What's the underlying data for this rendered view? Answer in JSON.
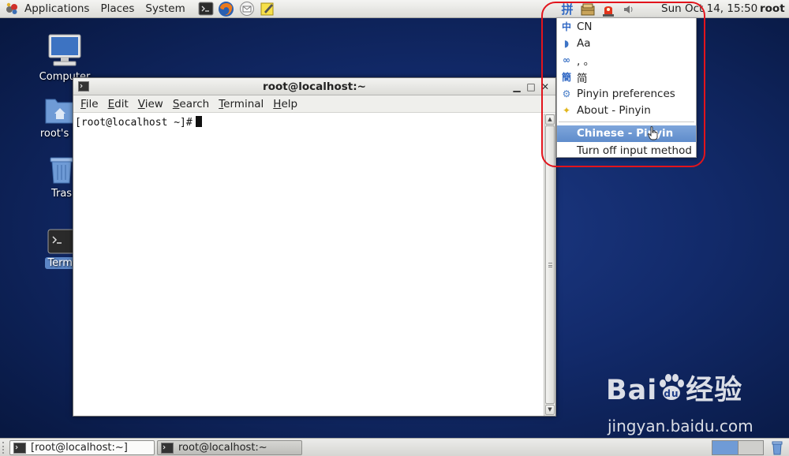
{
  "top_panel": {
    "menus": [
      "Applications",
      "Places",
      "System"
    ],
    "clock": "Sun Oct 14, 15:50",
    "user": "root"
  },
  "desktop": {
    "icons": [
      {
        "label": "Computer",
        "name": "computer"
      },
      {
        "label": "root's H",
        "name": "home"
      },
      {
        "label": "Tras",
        "name": "trash"
      },
      {
        "label": "Termi",
        "name": "terminal"
      }
    ]
  },
  "terminal": {
    "title": "root@localhost:~",
    "menu": [
      {
        "accel": "F",
        "rest": "ile"
      },
      {
        "accel": "E",
        "rest": "dit"
      },
      {
        "accel": "V",
        "rest": "iew"
      },
      {
        "accel": "S",
        "rest": "earch"
      },
      {
        "accel": "T",
        "rest": "erminal"
      },
      {
        "accel": "H",
        "rest": "elp"
      }
    ],
    "prompt": "[root@localhost ~]#"
  },
  "im_menu": {
    "tray_glyph": "拼",
    "items": [
      {
        "icon_glyph": "中",
        "label": "CN"
      },
      {
        "icon_glyph": "◗",
        "label": "Aa"
      },
      {
        "icon_glyph": "∞",
        "label": ", 。"
      },
      {
        "icon_glyph": "簡",
        "label": "简"
      },
      {
        "icon_glyph": "⚙",
        "label": "Pinyin preferences"
      },
      {
        "icon_glyph": "✦",
        "label": "About - Pinyin"
      }
    ],
    "selected": "Chinese - Pinyin",
    "off": "Turn off input method"
  },
  "taskbar": {
    "tasks": [
      "[root@localhost:~]",
      "root@localhost:~"
    ]
  },
  "watermark": {
    "main": "Bai",
    "main_tail": "经验",
    "sub": "jingyan.baidu.com"
  },
  "colors": {
    "accent": "#5f8ccb",
    "annotation": "#e2141c",
    "desktop_bg": "#122a6a"
  }
}
